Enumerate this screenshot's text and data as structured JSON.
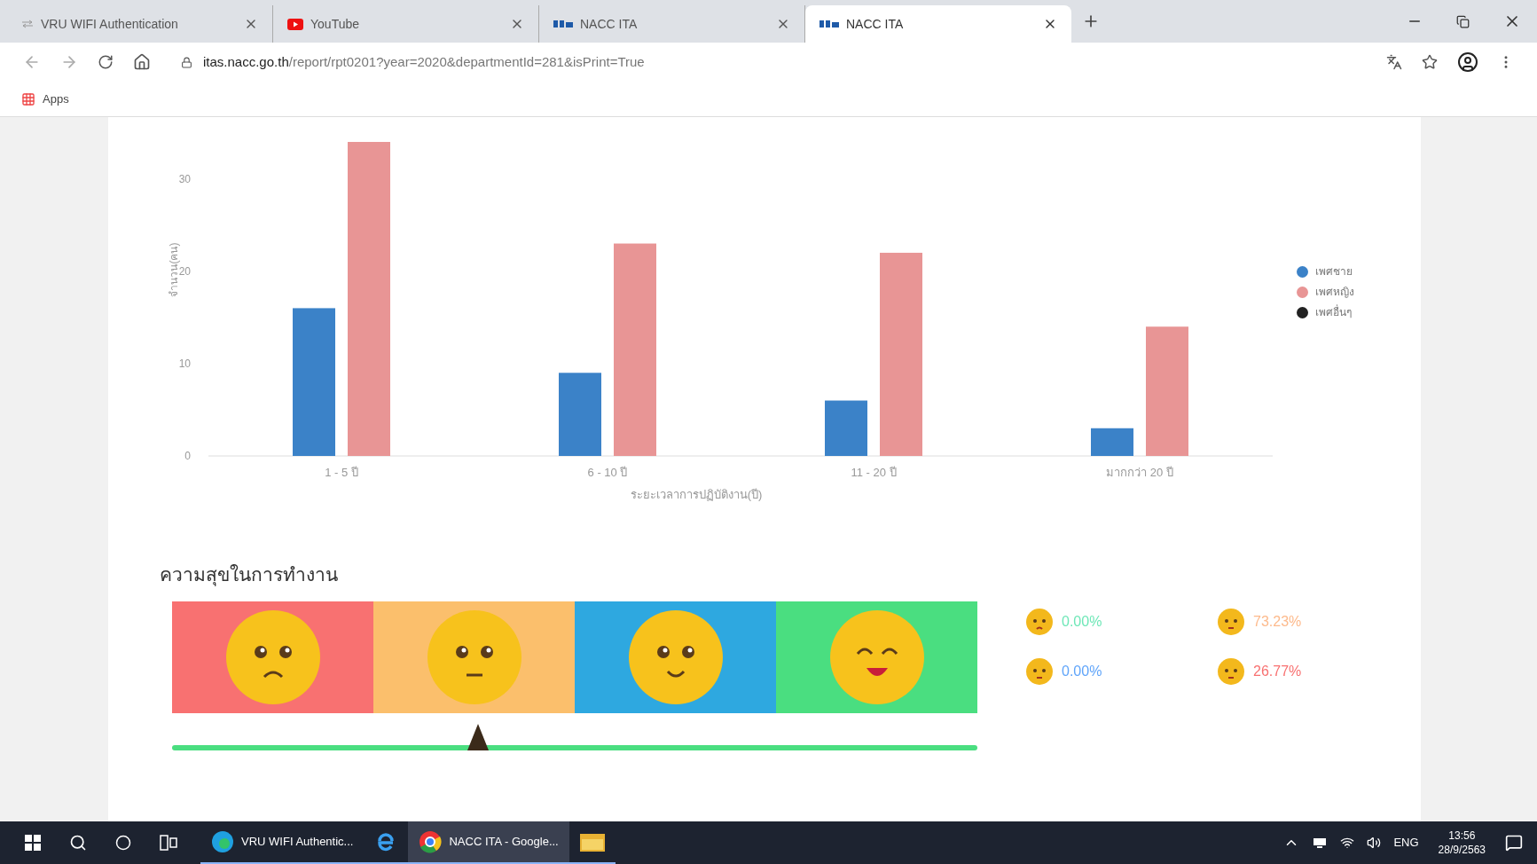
{
  "browser": {
    "tabs": [
      {
        "title": "VRU WIFI Authentication",
        "selected": false
      },
      {
        "title": "YouTube",
        "selected": false
      },
      {
        "title": "NACC ITA",
        "selected": false
      },
      {
        "title": "NACC ITA",
        "selected": true
      }
    ],
    "address": {
      "host": "itas.nacc.go.th",
      "path": "/report/rpt0201?year=2020&departmentId=281&isPrint=True"
    },
    "bookmarks": [
      "Apps"
    ]
  },
  "chart": {
    "chart_data": {
      "type": "bar",
      "ylabel": "จำนวน(คน)",
      "xlabel": "ระยะเวลาการปฏิบัติงาน(ปี)",
      "categories": [
        "1 - 5 ปี",
        "6 - 10 ปี",
        "11 - 20 ปี",
        "มากกว่า 20 ปี"
      ],
      "series": [
        {
          "name": "เพศชาย",
          "color": "#3b82c8",
          "values": [
            16,
            9,
            6,
            3
          ]
        },
        {
          "name": "เพศหญิง",
          "color": "#e89595",
          "values": [
            34,
            23,
            22,
            14
          ]
        },
        {
          "name": "เพศอื่นๆ",
          "color": "#222222",
          "values": [
            0,
            0,
            0,
            0
          ]
        }
      ],
      "ylim": [
        0,
        34
      ],
      "yticks": [
        0,
        10,
        20,
        30
      ],
      "legend": "right"
    }
  },
  "happiness": {
    "title": "ความสุขในการทำงาน",
    "segments": [
      {
        "kind": "sad",
        "color": "#f87171"
      },
      {
        "kind": "neutral",
        "color": "#fbbf6c"
      },
      {
        "kind": "smile",
        "color": "#2ea8e0"
      },
      {
        "kind": "happy",
        "color": "#4ade80"
      }
    ],
    "slider": {
      "level": 0.38
    },
    "stats": [
      {
        "value": "0.00%",
        "color": "#6ee7b7"
      },
      {
        "value": "73.23%",
        "color": "#fdba8c"
      },
      {
        "value": "0.00%",
        "color": "#60a5fa"
      },
      {
        "value": "26.77%",
        "color": "#f87171"
      }
    ]
  },
  "taskbar": {
    "apps": [
      {
        "label": "VRU WIFI Authentic...",
        "selected": false
      },
      {
        "selected": false
      },
      {
        "label": "NACC ITA - Google...",
        "selected": true
      },
      {
        "selected": false
      }
    ],
    "language": "ENG",
    "time": "13:56",
    "date": "28/9/2563"
  }
}
